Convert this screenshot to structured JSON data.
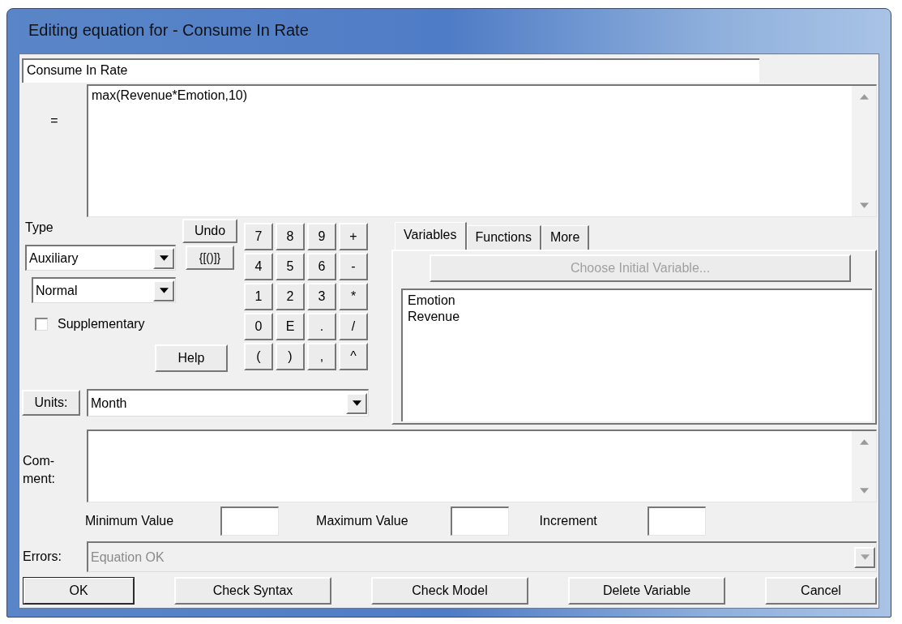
{
  "window": {
    "title": "Editing equation for - Consume In Rate"
  },
  "variable_name": {
    "value": "Consume In Rate"
  },
  "equation": {
    "label": "=",
    "value": "max(Revenue*Emotion,10)"
  },
  "type": {
    "label": "Type",
    "value": "Auxiliary"
  },
  "subtype": {
    "value": "Normal"
  },
  "supplementary": {
    "label": "Supplementary",
    "checked": false
  },
  "undo_button": "Undo",
  "brackets_button": "{[()]}",
  "help_button": "Help",
  "keypad": [
    "7",
    "8",
    "9",
    "+",
    "4",
    "5",
    "6",
    "-",
    "1",
    "2",
    "3",
    "*",
    "0",
    "E",
    ".",
    "/",
    "(",
    ")",
    ",",
    "^"
  ],
  "units": {
    "label": "Units:",
    "value": "Month"
  },
  "tabs": [
    {
      "label": "Variables",
      "selected": true
    },
    {
      "label": "Functions",
      "selected": false
    },
    {
      "label": "More",
      "selected": false
    }
  ],
  "choose_button": {
    "label": "Choose Initial Variable...",
    "disabled": true
  },
  "variables": [
    "Emotion",
    "Revenue"
  ],
  "comment": {
    "label_lines": [
      "Com-",
      "ment:"
    ]
  },
  "range_fields": [
    {
      "label": "Minimum Value"
    },
    {
      "label": "Maximum Value"
    },
    {
      "label": "Increment"
    }
  ],
  "errors": {
    "label": "Errors:",
    "value": "Equation OK",
    "disabled": true
  },
  "buttons": [
    {
      "label": "OK",
      "default": true
    },
    {
      "label": "Check Syntax",
      "default": false
    },
    {
      "label": "Check Model",
      "default": false
    },
    {
      "label": "Delete Variable",
      "default": false
    },
    {
      "label": "Cancel",
      "default": false
    }
  ]
}
